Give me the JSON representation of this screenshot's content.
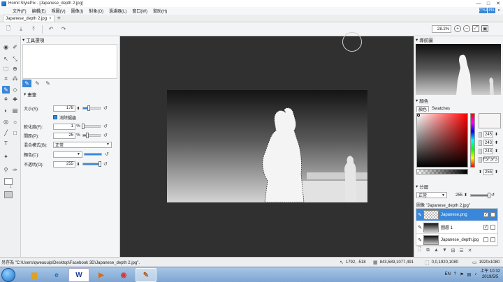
{
  "window": {
    "title": "Hornil StylePix - [Japanese_depth 2.jpg]",
    "controls": [
      "—",
      "□",
      "✕"
    ]
  },
  "menu": {
    "items": [
      "文件(F)",
      "編輯(E)",
      "視圖(V)",
      "圖像(I)",
      "對象(O)",
      "過濾器(L)",
      "窗口(W)",
      "幫助(H)"
    ],
    "right_buttons": [
      "STYLE",
      "PIX"
    ]
  },
  "tabs": [
    {
      "label": "Japanese_depth 2.jpg",
      "close": "×"
    }
  ],
  "tab_add": "+",
  "toolbar": {
    "zoom": "28.2%"
  },
  "tool_panel": {
    "title": "工具選項",
    "brush_section": "畫筆",
    "size_label": "大小(S):",
    "size_value": "178",
    "antialias_label": "消除鋸齒",
    "softness_label": "軟化度(F):",
    "softness_value": "1",
    "softness_unit": "%",
    "softness_fill": 0.01,
    "spacing_label": "間距(P):",
    "spacing_value": "25",
    "spacing_unit": "%",
    "spacing_fill": 0.25,
    "blend_label": "混合模式(B):",
    "blend_value": "正常",
    "color_label": "顏色(C):",
    "opacity_label": "不透明(O):",
    "opacity_value": "255",
    "size_fill": 0.35,
    "opacity_fill": 1.0
  },
  "navigator": {
    "title": "導航圖"
  },
  "color_panel": {
    "title": "顏色",
    "tabs": [
      "顏色",
      "Swatches"
    ],
    "r": "245",
    "g": "243",
    "b": "243",
    "hex": "F5F3F3",
    "alpha": "255",
    "current_color": "#f5f3f3"
  },
  "layers_panel": {
    "title": "分層",
    "blend_mode": "正常",
    "opacity": "255",
    "opacity_fill": 1.0,
    "caption": "圖像 \"Japanese_depth 2.jpg\"",
    "layers": [
      {
        "name": "Japanese.png",
        "checked": true
      },
      {
        "name": "圖層 1",
        "checked": true
      },
      {
        "name": "Japanese_depth.jpg",
        "checked": false
      }
    ]
  },
  "statusbar": {
    "message": "另存為 \"C:\\Users\\qweuuuip\\Desktop\\Facebook 3D\\Japanese_depth 2.jpg\".",
    "cursor_pos": "1792, -518",
    "color_info": "843,589,1077,491",
    "selection": "0,0,1920,1080",
    "size": "1920x1080"
  },
  "taskbar": {
    "lang": "EN",
    "time": "上午 10:32",
    "date": "2019/5/5"
  }
}
